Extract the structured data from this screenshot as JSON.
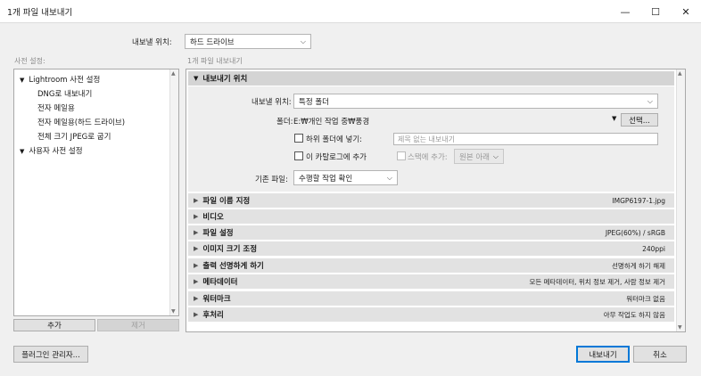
{
  "window": {
    "title": "1개 파일 내보내기",
    "controls": {
      "minimize": "—",
      "maximize": "☐",
      "close": "✕"
    }
  },
  "export_to": {
    "label": "내보낼 위치:",
    "value": "하드 드라이브"
  },
  "presets": {
    "header": "사전 설정:",
    "groups": [
      {
        "name": "Lightroom 사전 설정",
        "items": [
          "DNG로 내보내기",
          "전자 메일용",
          "전자 메일용(하드 드라이브)",
          "전체 크기 JPEG로 굽기"
        ]
      },
      {
        "name": "사용자 사전 설정",
        "items": []
      }
    ],
    "add_button": "추가",
    "remove_button": "제거"
  },
  "main": {
    "header": "1개 파일 내보내기",
    "location_section": {
      "title": "내보내기 위치",
      "export_to_label": "내보낼 위치:",
      "export_to_value": "특정 폴더",
      "folder_label": "폴더:",
      "folder_path": "E:₩개인 작업 중₩풍경",
      "choose_button": "선택...",
      "subfolder_label": "하위 폴더에 넣기:",
      "subfolder_placeholder": "제목 없는 내보내기",
      "add_catalog_label": "이 카탈로그에 추가",
      "add_stack_label": "스택에 추가:",
      "stack_position": "원본 아래",
      "existing_files_label": "기존 파일:",
      "existing_files_value": "수행할 작업 확인"
    },
    "sections": [
      {
        "title": "파일 이름 지정",
        "summary": "IMGP6197-1.jpg"
      },
      {
        "title": "비디오",
        "summary": ""
      },
      {
        "title": "파일 설정",
        "summary": "JPEG(60%) / sRGB"
      },
      {
        "title": "이미지 크기 조정",
        "summary": "240ppi"
      },
      {
        "title": "출력 선명하게 하기",
        "summary": "선명하게 하기 해제"
      },
      {
        "title": "메타데이터",
        "summary": "모든 메타데이터, 위치 정보 제거, 사람 정보 제거"
      },
      {
        "title": "워터마크",
        "summary": "워터마크 없음"
      },
      {
        "title": "후처리",
        "summary": "아무 작업도 하지 않음"
      }
    ]
  },
  "footer": {
    "plugin_manager": "플러그인 관리자...",
    "export_button": "내보내기",
    "cancel_button": "취소"
  }
}
